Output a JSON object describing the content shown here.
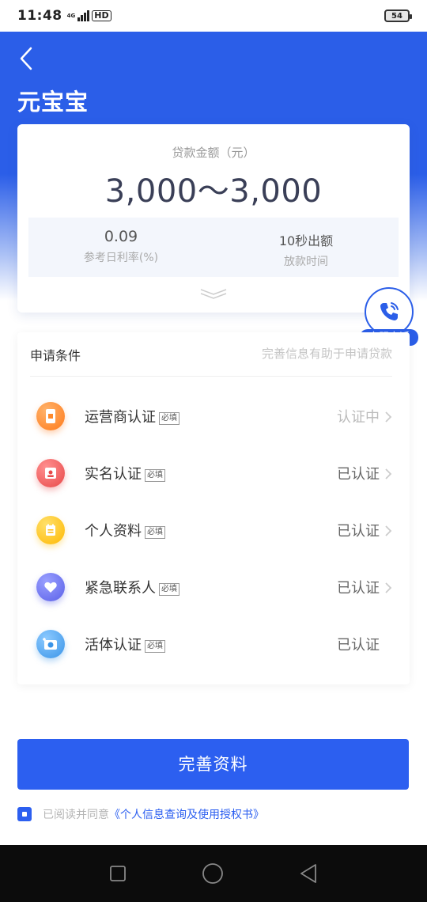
{
  "status_bar": {
    "time": "11:48",
    "network": "4G",
    "hd": "HD",
    "battery": "54"
  },
  "header": {
    "title": "元宝宝"
  },
  "loan": {
    "label": "贷款金额（元）",
    "amount": "3,000～3,000",
    "rate_value": "0.09",
    "rate_label": "参考日利率(%)",
    "time_value": "10秒出额",
    "time_label": "放款时间"
  },
  "customer_service": {
    "label": "客服电话"
  },
  "conditions": {
    "title": "申请条件",
    "hint": "完善信息有助于申请贷款",
    "items": [
      {
        "name": "运营商认证",
        "tag": "必填",
        "status": "认证中",
        "icon": "phone-card-icon",
        "color": "#ff8a2b"
      },
      {
        "name": "实名认证",
        "tag": "必填",
        "status": "已认证",
        "icon": "id-card-icon",
        "color": "#ef5858"
      },
      {
        "name": "个人资料",
        "tag": "必填",
        "status": "已认证",
        "icon": "profile-icon",
        "color": "#ffc61a"
      },
      {
        "name": "紧急联系人",
        "tag": "必填",
        "status": "已认证",
        "icon": "heart-icon",
        "color": "#6b73f0"
      },
      {
        "name": "活体认证",
        "tag": "必填",
        "status": "已认证",
        "icon": "camera-icon",
        "color": "#4aa6f0"
      }
    ]
  },
  "submit": {
    "label": "完善资料"
  },
  "agreement": {
    "prefix": "已阅读并同意",
    "link": "《个人信息查询及使用授权书》"
  }
}
